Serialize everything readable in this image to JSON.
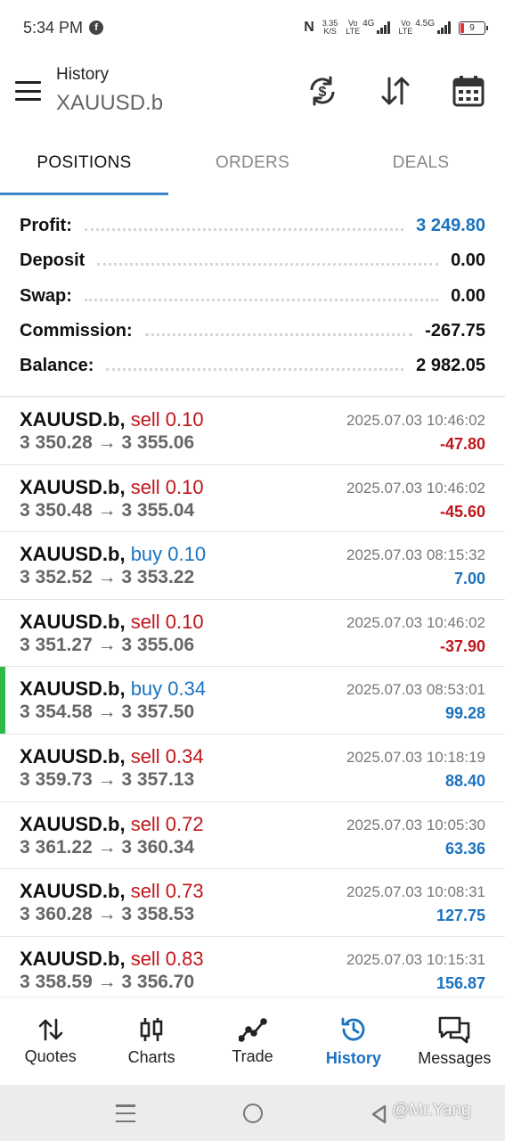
{
  "status_bar": {
    "time": "5:34 PM",
    "speed_value": "3.35",
    "speed_unit": "K/S",
    "net1_top": "Vo",
    "net1_bottom": "LTE",
    "net1_gen": "4G",
    "net2_top": "Vo",
    "net2_bottom": "LTE",
    "net2_gen": "4.5G",
    "battery": "9"
  },
  "header": {
    "title": "History",
    "subtitle": "XAUUSD.b",
    "icons": [
      "menu-icon",
      "currency-exchange-icon",
      "sort-icon",
      "calendar-icon"
    ]
  },
  "tabs": [
    {
      "label": "POSITIONS",
      "active": true
    },
    {
      "label": "ORDERS",
      "active": false
    },
    {
      "label": "DEALS",
      "active": false
    }
  ],
  "summary": [
    {
      "label": "Profit:",
      "value": "3 249.80",
      "color": "#1a72c0"
    },
    {
      "label": "Deposit",
      "value": "0.00"
    },
    {
      "label": "Swap:",
      "value": "0.00"
    },
    {
      "label": "Commission:",
      "value": "-267.75"
    },
    {
      "label": "Balance:",
      "value": "2 982.05"
    }
  ],
  "positions": [
    {
      "symbol": "XAUUSD.b,",
      "side": "sell 0.10",
      "type": "sell",
      "prices": "3 350.28 → 3 355.06",
      "time": "2025.07.03 10:46:02",
      "profit": "-47.80"
    },
    {
      "symbol": "XAUUSD.b,",
      "side": "sell 0.10",
      "type": "sell",
      "prices": "3 350.48 → 3 355.04",
      "time": "2025.07.03 10:46:02",
      "profit": "-45.60"
    },
    {
      "symbol": "XAUUSD.b,",
      "side": "buy 0.10",
      "type": "buy",
      "prices": "3 352.52 → 3 353.22",
      "time": "2025.07.03 08:15:32",
      "profit": "7.00"
    },
    {
      "symbol": "XAUUSD.b,",
      "side": "sell 0.10",
      "type": "sell",
      "prices": "3 351.27 → 3 355.06",
      "time": "2025.07.03 10:46:02",
      "profit": "-37.90"
    },
    {
      "symbol": "XAUUSD.b,",
      "side": "buy 0.34",
      "type": "buy",
      "prices": "3 354.58 → 3 357.50",
      "time": "2025.07.03 08:53:01",
      "profit": "99.28"
    },
    {
      "symbol": "XAUUSD.b,",
      "side": "sell 0.34",
      "type": "sell",
      "prices": "3 359.73 → 3 357.13",
      "time": "2025.07.03 10:18:19",
      "profit": "88.40"
    },
    {
      "symbol": "XAUUSD.b,",
      "side": "sell 0.72",
      "type": "sell",
      "prices": "3 361.22 → 3 360.34",
      "time": "2025.07.03 10:05:30",
      "profit": "63.36"
    },
    {
      "symbol": "XAUUSD.b,",
      "side": "sell 0.73",
      "type": "sell",
      "prices": "3 360.28 → 3 358.53",
      "time": "2025.07.03 10:08:31",
      "profit": "127.75"
    },
    {
      "symbol": "XAUUSD.b,",
      "side": "sell 0.83",
      "type": "sell",
      "prices": "3 358.59 → 3 356.70",
      "time": "2025.07.03 10:15:31",
      "profit": "156.87"
    }
  ],
  "colors": {
    "accent": "#1a72c0",
    "sell": "#c0161b",
    "buy": "#1a72c0",
    "marker": "#2db84a"
  },
  "bottom_nav": [
    {
      "label": "Quotes",
      "icon": "quotes-icon",
      "active": false
    },
    {
      "label": "Charts",
      "icon": "candlestick-icon",
      "active": false
    },
    {
      "label": "Trade",
      "icon": "trade-line-icon",
      "active": false
    },
    {
      "label": "History",
      "icon": "history-icon",
      "active": true
    },
    {
      "label": "Messages",
      "icon": "messages-icon",
      "active": false
    }
  ],
  "watermark": "@Mr.Yang"
}
